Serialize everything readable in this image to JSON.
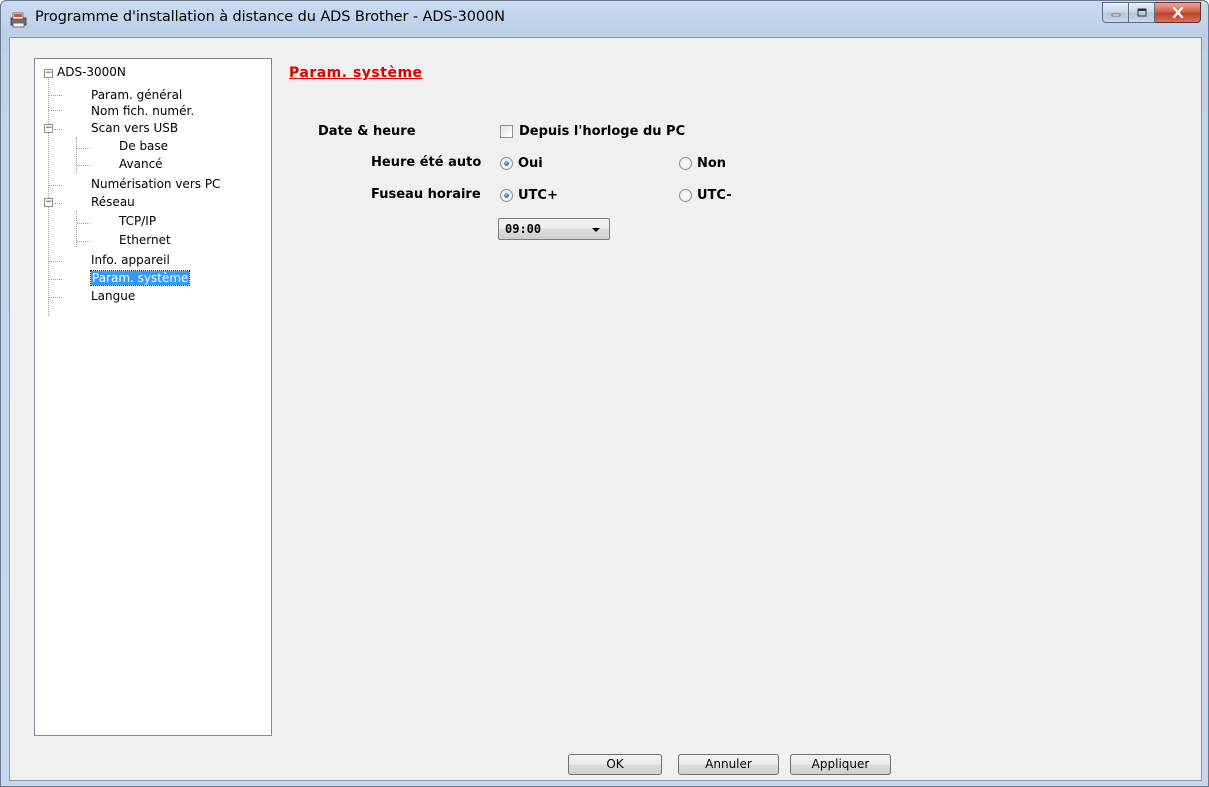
{
  "window": {
    "title": "Programme d'installation à distance du ADS Brother - ADS-3000N",
    "icon": "printer-app-icon",
    "caption_buttons": [
      "minimize-icon",
      "maximize-icon",
      "close-icon"
    ]
  },
  "tree": {
    "root": {
      "label": "ADS-3000N",
      "expanded": true
    },
    "items": [
      {
        "label": "Param. général",
        "level": 1
      },
      {
        "label": "Nom fich. numér.",
        "level": 1
      },
      {
        "label": "Scan vers USB",
        "level": 1,
        "expanded": true
      },
      {
        "label": "De base",
        "level": 2
      },
      {
        "label": "Avancé",
        "level": 2
      },
      {
        "label": "Numérisation vers PC",
        "level": 1
      },
      {
        "label": "Réseau",
        "level": 1,
        "expanded": true
      },
      {
        "label": "TCP/IP",
        "level": 2
      },
      {
        "label": "Ethernet",
        "level": 2
      },
      {
        "label": "Info. appareil",
        "level": 1
      },
      {
        "label": "Param. système",
        "level": 1,
        "selected": true
      },
      {
        "label": "Langue",
        "level": 1
      }
    ]
  },
  "main": {
    "section_title": "Param. système",
    "date_time": {
      "label": "Date & heure",
      "from_pc_clock": {
        "label": "Depuis l'horloge du PC",
        "checked": false
      }
    },
    "dst": {
      "label": "Heure été auto",
      "options": [
        {
          "label": "Oui",
          "checked": true
        },
        {
          "label": "Non",
          "checked": false
        }
      ]
    },
    "timezone": {
      "label": "Fuseau horaire",
      "options": [
        {
          "label": "UTC+",
          "checked": true
        },
        {
          "label": "UTC-",
          "checked": false
        }
      ],
      "offset_value": "09:00"
    }
  },
  "buttons": {
    "ok": "OK",
    "cancel": "Annuler",
    "apply": "Appliquer"
  }
}
